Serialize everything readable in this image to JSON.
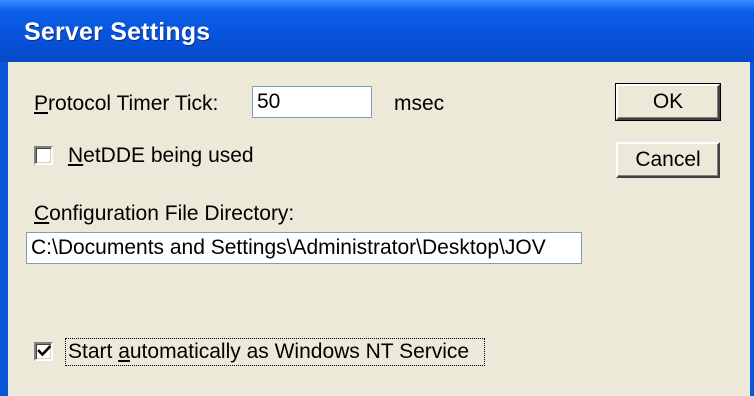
{
  "window": {
    "title": "Server Settings"
  },
  "protocol_timer": {
    "label_prefix": "",
    "label_mnemonic": "P",
    "label_rest": "rotocol Timer Tick:",
    "value": "50",
    "unit": "msec"
  },
  "netdde": {
    "label_mnemonic": "N",
    "label_rest": "etDDE being used",
    "checked": false
  },
  "config_dir": {
    "label_mnemonic": "C",
    "label_rest": "onfiguration File Directory:",
    "value": "C:\\Documents and Settings\\Administrator\\Desktop\\JOV"
  },
  "nt_service": {
    "label_prefix": "Start ",
    "label_mnemonic": "a",
    "label_rest": "utomatically as Windows NT Service",
    "checked": true
  },
  "buttons": {
    "ok_label": "OK",
    "cancel_label": "Cancel"
  },
  "colors": {
    "titlebar": "#0754dd",
    "client": "#ece9d8",
    "title_text": "#ffffff"
  }
}
